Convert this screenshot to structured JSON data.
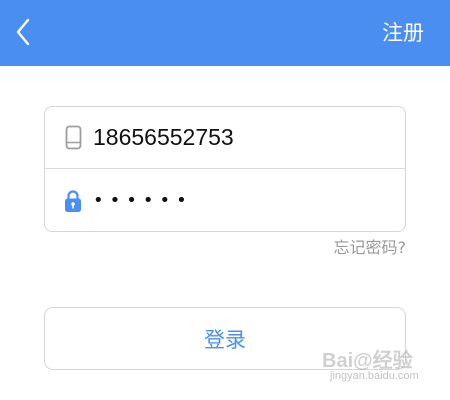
{
  "header": {
    "register_label": "注册",
    "bar_color": "#4a8ef2",
    "back_icon": "chevron-left-icon"
  },
  "form": {
    "phone_value": "18656552753",
    "phone_icon": "phone-icon",
    "password_masked": "••••••",
    "password_icon": "lock-icon",
    "forgot_label": "忘记密码?"
  },
  "actions": {
    "login_label": "登录"
  },
  "watermark": {
    "main": "Bai@经验",
    "sub": "jingyan.baidu.com"
  }
}
